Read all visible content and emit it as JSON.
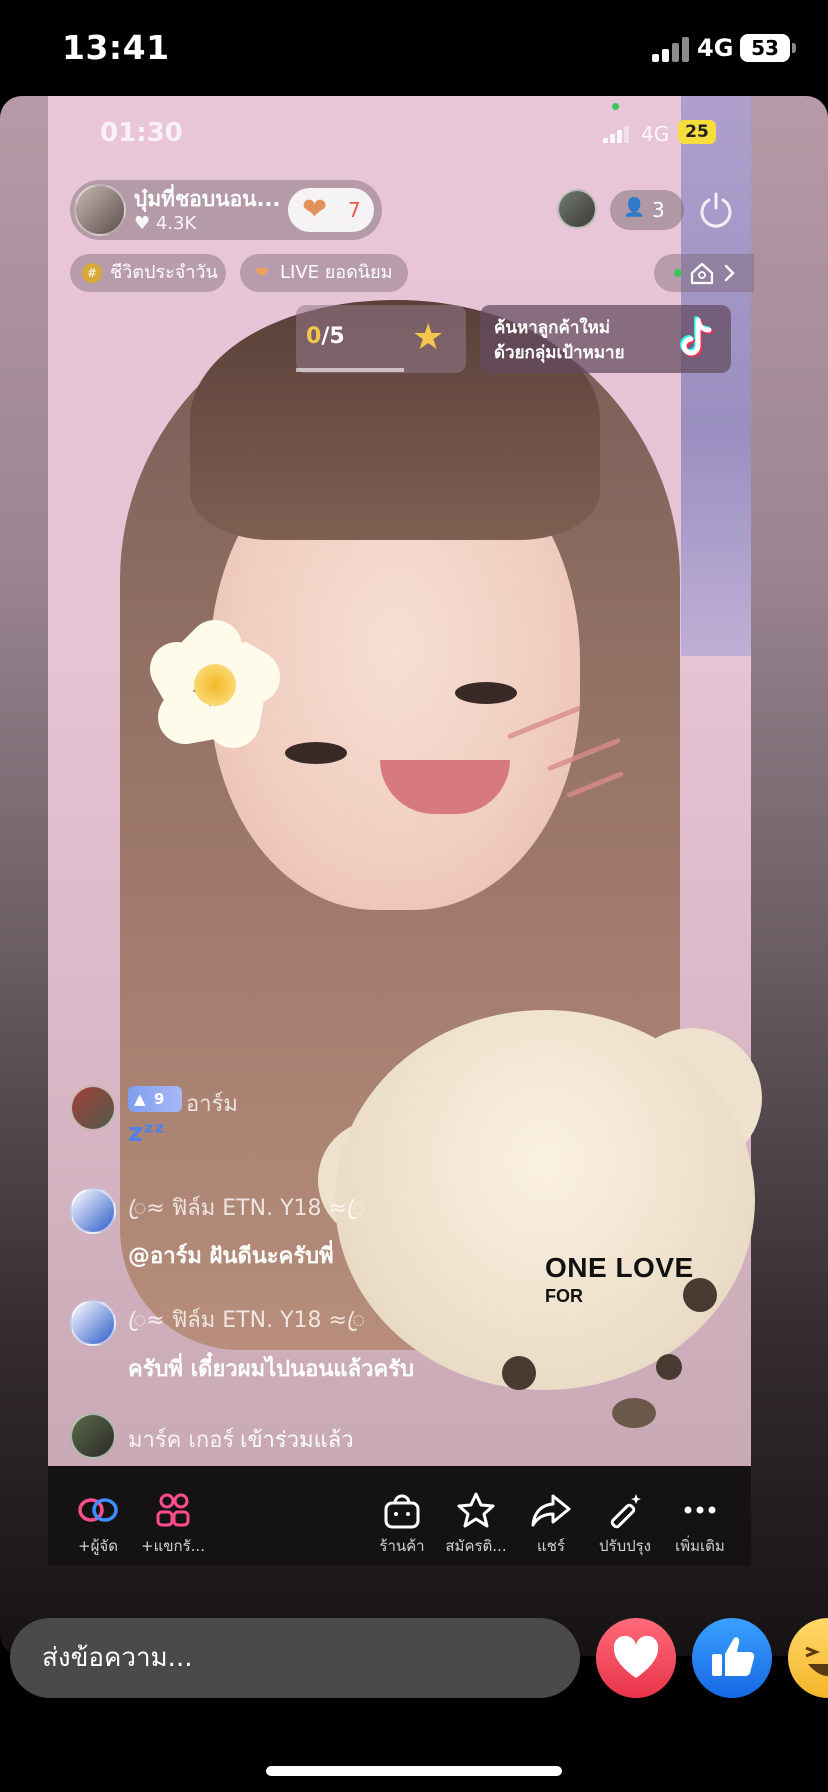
{
  "outer_status": {
    "time": "13:41",
    "network": "4G",
    "battery": "53"
  },
  "inner_status": {
    "time": "01:30",
    "network": "4G",
    "battery": "25"
  },
  "live": {
    "host_name": "บุ๋มที่ชอบนอน...",
    "host_likes": "4.3K",
    "gift_count": "7",
    "viewer_count": "3",
    "tags": [
      "ชีวิตประจำวัน",
      "LIVE ยอดนิยม"
    ]
  },
  "goal": {
    "current": "0",
    "total": "/5"
  },
  "promo": {
    "line1": "ค้นหาลูกค้าใหม่",
    "line2": "ด้วยกลุ่มเป้าหมาย"
  },
  "overlay": {
    "shirt_line1": "ONE LOVE",
    "shirt_line2": "FOR"
  },
  "chat": [
    {
      "name": "อาร์ม",
      "level": "9",
      "message": "zᶻᶻ"
    },
    {
      "name": "ꦿ≈ ฟิล์ม  ETN.   Y18 ≈ꦿ",
      "message": "@อาร์ม ฝันดีนะครับพี่"
    },
    {
      "name": "ꦿ≈ ฟิล์ม  ETN.   Y18 ≈ꦿ",
      "message": "ครับพี่ เดี๋ยวผมไปนอนแล้วครับ"
    },
    {
      "name": "มาร์ค เกอร์",
      "message": "เข้าร่วมแล้ว"
    }
  ],
  "actions": [
    {
      "label": "+ผู้จัด",
      "icon": "cohost-link-icon"
    },
    {
      "label": "+แขกรั...",
      "icon": "guests-icon"
    },
    {
      "label": "ร้านค้า",
      "icon": "shop-bag-icon"
    },
    {
      "label": "สมัครติ...",
      "icon": "subscribe-star-icon"
    },
    {
      "label": "แชร์",
      "icon": "share-icon"
    },
    {
      "label": "ปรับปรุง",
      "icon": "enhance-wand-icon"
    },
    {
      "label": "เพิ่มเติม",
      "icon": "more-icon"
    }
  ],
  "message_bar": {
    "placeholder": "ส่งข้อความ..."
  },
  "colors": {
    "heart": "#e8334a",
    "like": "#1668e3",
    "accent_gold": "#f2c74c"
  }
}
